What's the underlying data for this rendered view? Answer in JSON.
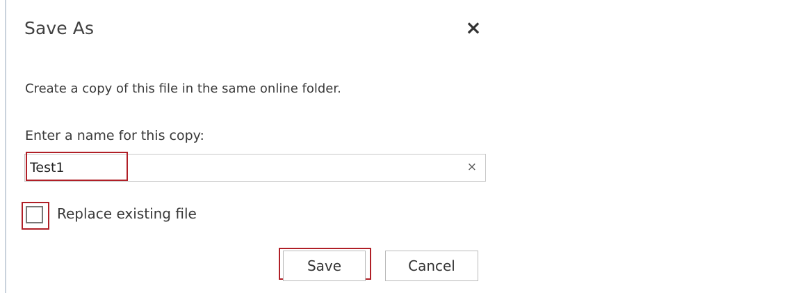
{
  "dialog": {
    "title": "Save As",
    "close_icon": "close-icon",
    "description": "Create a copy of this file in the same online folder.",
    "name_label": "Enter a name for this copy:",
    "name_value": "Test1",
    "clear_icon": "clear-icon",
    "replace_label": "Replace existing file",
    "save_label": "Save",
    "cancel_label": "Cancel",
    "highlight_color": "#b01f27"
  }
}
